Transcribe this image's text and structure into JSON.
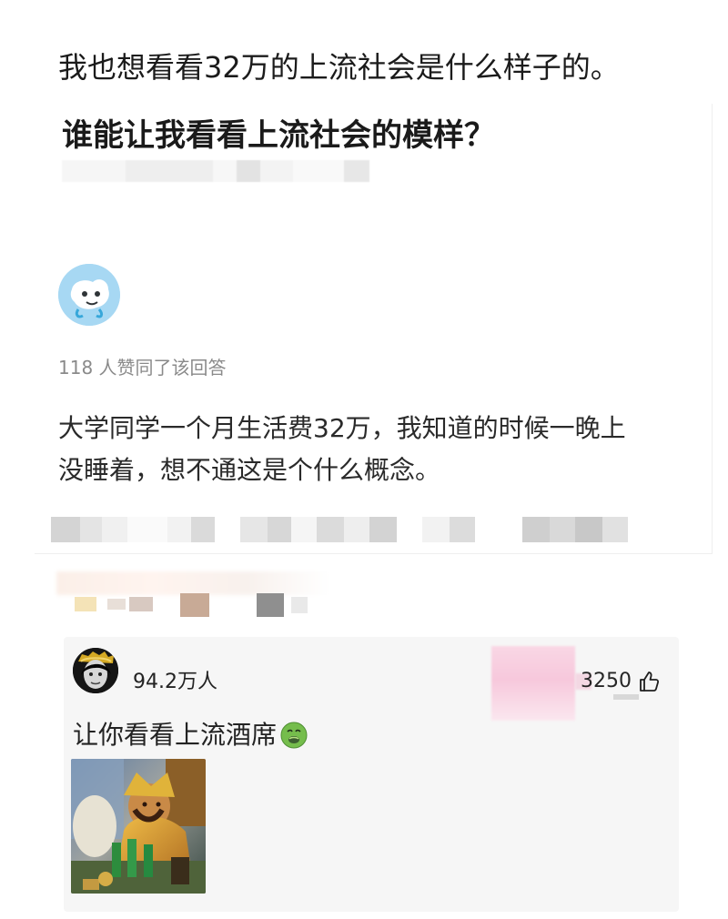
{
  "post": {
    "caption": "我也想看看32万的上流社会是什么样子的。"
  },
  "question": {
    "title": "谁能让我看看上流社会的模样？"
  },
  "answer": {
    "upvote_note": "118 人赞同了该回答",
    "lines": [
      "大学同学一个月生活费32万，我知道的时候一晚上",
      "没睡着，想不通这是个什么概念。"
    ]
  },
  "comment": {
    "user_name": "94.2万人",
    "likes": "3250",
    "text": "让你看看上流酒席",
    "emoji": "nauseated-face-emoji"
  },
  "icons": {
    "avatar": "cartoon-avatar-icon",
    "comment_avatar": "user-avatar-icon",
    "like": "thumb-up-icon",
    "image": "banquet-photo"
  },
  "colors": {
    "page_background": "#ffffff",
    "text": "#1f1f1f",
    "muted_text": "#8a8a8a",
    "comment_background": "#f6f6f6",
    "avatar_blue": "#a7d8f3"
  }
}
